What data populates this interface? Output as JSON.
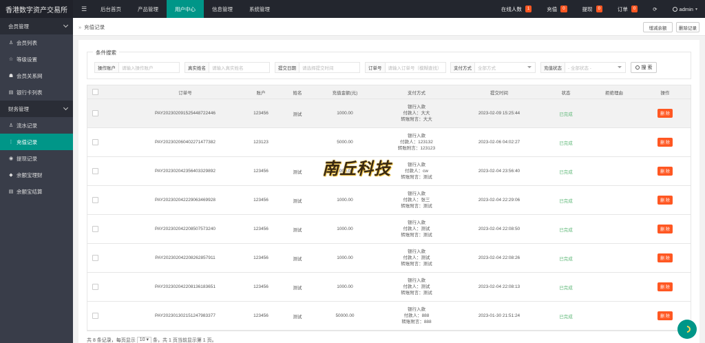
{
  "app": {
    "title": "香港数字资产交易所"
  },
  "header": {
    "menu_icon": "hamburger-icon",
    "nav": [
      {
        "label": "后台首页",
        "active": false
      },
      {
        "label": "产品管理",
        "active": false
      },
      {
        "label": "用户中心",
        "active": true
      },
      {
        "label": "信息管理",
        "active": false
      },
      {
        "label": "系统管理",
        "active": false
      }
    ],
    "online": {
      "label": "在线人数",
      "count": "1"
    },
    "recharge": {
      "label": "充值",
      "count": "0"
    },
    "withdraw": {
      "label": "提现",
      "count": "0"
    },
    "orders": {
      "label": "订单",
      "count": "0"
    },
    "refresh_icon": "refresh-icon",
    "user": "admin"
  },
  "sidebar": {
    "groups": [
      {
        "label": "会员管理",
        "items": [
          {
            "label": "会员列表",
            "icon": "user-icon"
          },
          {
            "label": "等级设置",
            "icon": "star-icon"
          },
          {
            "label": "会员关系网",
            "icon": "users-icon"
          },
          {
            "label": "银行卡列表",
            "icon": "card-icon"
          }
        ]
      },
      {
        "label": "财务管理",
        "items": [
          {
            "label": "流水记录",
            "icon": "user-icon"
          },
          {
            "label": "充值记录",
            "icon": "menu-dots-icon",
            "active": true
          },
          {
            "label": "提现记录",
            "icon": "circle-icon"
          },
          {
            "label": "余额宝理财",
            "icon": "diamond-icon"
          },
          {
            "label": "余额宝结算",
            "icon": "list-icon"
          }
        ]
      }
    ]
  },
  "breadcrumb": {
    "text": "充值记录"
  },
  "toolbar": {
    "add_balance": "增减余额",
    "delete_records": "删除记录"
  },
  "search": {
    "legend": "条件搜索",
    "operator": {
      "label": "操作账户",
      "placeholder": "请输入操作账户"
    },
    "realname": {
      "label": "真实姓名",
      "placeholder": "请输入真实姓名"
    },
    "date": {
      "label": "提交日期",
      "placeholder": "请选择提交时间"
    },
    "order": {
      "label": "订单号",
      "placeholder": "请输入订单号（模糊查找）"
    },
    "paymethod": {
      "label": "支付方式",
      "placeholder": "全部方式"
    },
    "status": {
      "label": "充值状态",
      "placeholder": "- 全部状态 -"
    },
    "button": "搜 索"
  },
  "table": {
    "headers": [
      "订单号",
      "账户",
      "姓名",
      "充值金额(元)",
      "支付方式",
      "提交时间",
      "状态",
      "拒绝理由",
      "操作"
    ],
    "rows": [
      {
        "order": "PAY20230209152544872244​6",
        "account": "123456",
        "name": "测试",
        "amount": "1000.00",
        "pay1": "银行入款",
        "pay2": "付款人：大大",
        "pay3": "转账附言：大大",
        "time": "2023-02-09 15:25:44",
        "status": "已完成",
        "reason": "",
        "action": "删 除"
      },
      {
        "order": "PAY20230206040227147738​2",
        "account": "123123",
        "name": "",
        "amount": "5000.00",
        "pay1": "银行入款",
        "pay2": "付款人：123132",
        "pay3": "转账附言：123123",
        "time": "2023-02-06 04:02:27",
        "status": "已完成",
        "reason": "",
        "action": "删 除"
      },
      {
        "order": "PAY20230204235640332989​2",
        "account": "123456",
        "name": "测试",
        "amount": "2000.00",
        "pay1": "银行入款",
        "pay2": "付款人：cw",
        "pay3": "转账附言：测试",
        "time": "2023-02-04 23:56:40",
        "status": "已完成",
        "reason": "",
        "action": "删 除"
      },
      {
        "order": "PAY20230204222906346992​8",
        "account": "123456",
        "name": "测试",
        "amount": "1000.00",
        "pay1": "银行入款",
        "pay2": "付款人：张三",
        "pay3": "转账附言：测试",
        "time": "2023-02-04 22:29:06",
        "status": "已完成",
        "reason": "",
        "action": "删 除"
      },
      {
        "order": "PAY20230204220850757324​0",
        "account": "123456",
        "name": "测试",
        "amount": "1000.00",
        "pay1": "银行入款",
        "pay2": "付款人：测试",
        "pay3": "转账附言：测试",
        "time": "2023-02-04 22:08:50",
        "status": "已完成",
        "reason": "",
        "action": "删 除"
      },
      {
        "order": "PAY20230204220826285791​1",
        "account": "123456",
        "name": "测试",
        "amount": "1000.00",
        "pay1": "银行入款",
        "pay2": "付款人：测试",
        "pay3": "转账附言：测试",
        "time": "2023-02-04 22:08:26",
        "status": "已完成",
        "reason": "",
        "action": "删 除"
      },
      {
        "order": "PAY20230204220813618365​1",
        "account": "123456",
        "name": "测试",
        "amount": "1000.00",
        "pay1": "银行入款",
        "pay2": "付款人：测试",
        "pay3": "转账附言：测试",
        "time": "2023-02-04 22:08:13",
        "status": "已完成",
        "reason": "",
        "action": "删 除"
      },
      {
        "order": "PAY20230130215124798337​7",
        "account": "123456",
        "name": "测试",
        "amount": "50000.00",
        "pay1": "银行入款",
        "pay2": "付款人：888",
        "pay3": "转账附言：888",
        "time": "2023-01-30 21:51:24",
        "status": "已完成",
        "reason": "",
        "action": "删 除"
      }
    ]
  },
  "pager": {
    "pre": "共 8 条记录，每页显示",
    "size": "10 ▾",
    "post": "条，共 1 页当前显示第 1 页。"
  },
  "watermark": "南丘科技",
  "fab_icon": "chat-icon"
}
